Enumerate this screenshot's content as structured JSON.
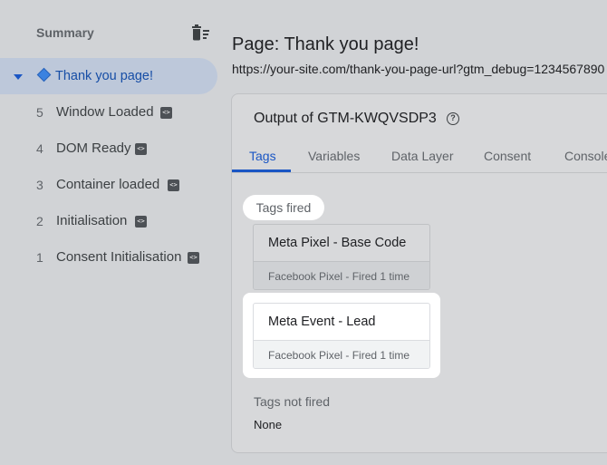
{
  "sidebar": {
    "summary_label": "Summary",
    "active_event": {
      "label": "Thank you page!"
    },
    "events": [
      {
        "number": "5",
        "label": "Window Loaded"
      },
      {
        "number": "4",
        "label": "DOM Ready"
      },
      {
        "number": "3",
        "label": "Container loaded"
      },
      {
        "number": "2",
        "label": "Initialisation"
      },
      {
        "number": "1",
        "label": "Consent Initialisation"
      }
    ]
  },
  "page": {
    "title": "Page: Thank you page!",
    "url": "https://your-site.com/thank-you-page-url?gtm_debug=1234567890"
  },
  "panel": {
    "title": "Output of GTM-KWQVSDP3",
    "tabs": [
      "Tags",
      "Variables",
      "Data Layer",
      "Consent",
      "Console"
    ],
    "active_tab": "Tags",
    "fired_label": "Tags fired",
    "fired_tags": [
      {
        "name": "Meta Pixel - Base Code",
        "status": "Facebook Pixel - Fired 1 time"
      },
      {
        "name": "Meta Event - Lead",
        "status": "Facebook Pixel - Fired 1 time"
      }
    ],
    "not_fired_label": "Tags not fired",
    "not_fired_value": "None"
  },
  "colors": {
    "accent": "#1a56c4",
    "overlay": "#d1d3d6",
    "active_item_bg": "#bdc8da"
  },
  "icons": [
    "delete-sweep-icon",
    "caret-down-icon",
    "diamond-icon",
    "code-icon",
    "help-icon"
  ]
}
